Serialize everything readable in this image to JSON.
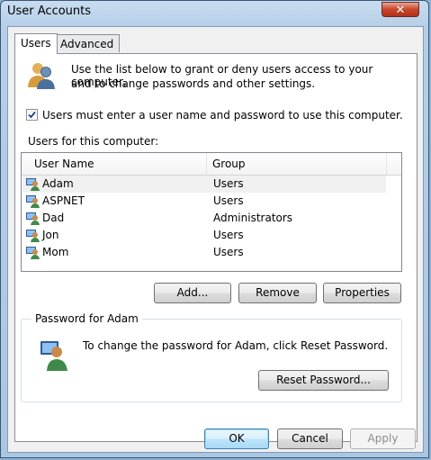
{
  "window": {
    "title": "User Accounts",
    "close_glyph": "✕"
  },
  "tabs": [
    {
      "label": "Users",
      "active": true
    },
    {
      "label": "Advanced",
      "active": false
    }
  ],
  "intro_text_line1": "Use the list below to grant or deny users access to your computer,",
  "intro_text_line2": "and to change passwords and other settings.",
  "require_login": {
    "label": "Users must enter a user name and password to use this computer.",
    "checked": true
  },
  "users_section_label": "Users for this computer:",
  "user_table": {
    "columns": [
      "User Name",
      "Group"
    ],
    "rows": [
      {
        "name": "Adam",
        "group": "Users",
        "selected": true
      },
      {
        "name": "ASPNET",
        "group": "Users",
        "selected": false
      },
      {
        "name": "Dad",
        "group": "Administrators",
        "selected": false
      },
      {
        "name": "Jon",
        "group": "Users",
        "selected": false
      },
      {
        "name": "Mom",
        "group": "Users",
        "selected": false
      }
    ]
  },
  "user_buttons": {
    "add": "Add...",
    "remove": "Remove",
    "properties": "Properties"
  },
  "password_group": {
    "title": "Password for Adam",
    "text": "To change the password for Adam, click Reset Password.",
    "reset_button": "Reset Password..."
  },
  "dialog_buttons": {
    "ok": "OK",
    "cancel": "Cancel",
    "apply": "Apply"
  },
  "icons": {
    "users_icon": "users-icon",
    "user_row_icon": "user-icon",
    "password_icon": "user-icon"
  }
}
